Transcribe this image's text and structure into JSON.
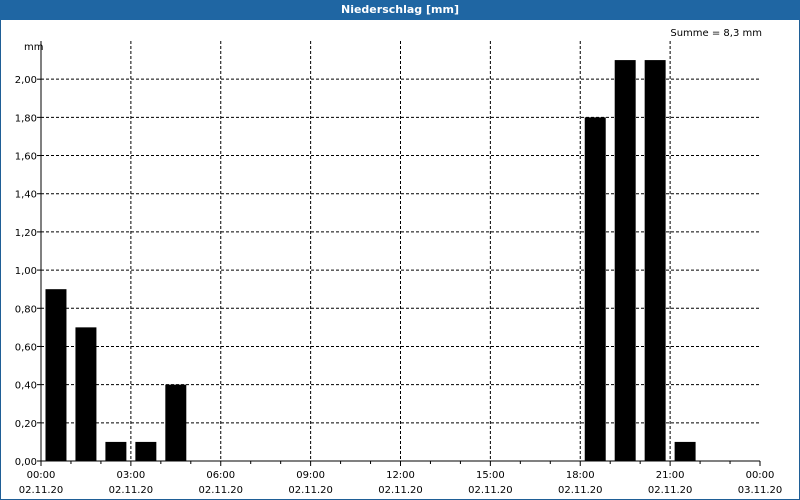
{
  "window": {
    "title": "Niederschlag [mm]"
  },
  "chart_data": {
    "type": "bar",
    "title": "Niederschlag [mm]",
    "ylabel": "mm",
    "ylim": [
      0,
      2.2
    ],
    "yticks": [
      "0,00",
      "0,20",
      "0,40",
      "0,60",
      "0,80",
      "1,00",
      "1,20",
      "1,40",
      "1,60",
      "1,80",
      "2,00"
    ],
    "xticks": [
      {
        "time": "00:00",
        "date": "02.11.20"
      },
      {
        "time": "03:00",
        "date": "02.11.20"
      },
      {
        "time": "06:00",
        "date": "02.11.20"
      },
      {
        "time": "09:00",
        "date": "02.11.20"
      },
      {
        "time": "12:00",
        "date": "02.11.20"
      },
      {
        "time": "15:00",
        "date": "02.11.20"
      },
      {
        "time": "18:00",
        "date": "02.11.20"
      },
      {
        "time": "21:00",
        "date": "02.11.20"
      },
      {
        "time": "00:00",
        "date": "03.11.20"
      }
    ],
    "xrange_hours": [
      0,
      24
    ],
    "bars": [
      {
        "start": "00:00",
        "end": "01:00",
        "value": 0.9
      },
      {
        "start": "01:00",
        "end": "02:00",
        "value": 0.7
      },
      {
        "start": "02:00",
        "end": "03:00",
        "value": 0.1
      },
      {
        "start": "03:00",
        "end": "04:00",
        "value": 0.1
      },
      {
        "start": "04:00",
        "end": "05:00",
        "value": 0.4
      },
      {
        "start": "18:00",
        "end": "19:00",
        "value": 1.8
      },
      {
        "start": "19:00",
        "end": "20:00",
        "value": 2.1
      },
      {
        "start": "20:00",
        "end": "21:00",
        "value": 2.1
      },
      {
        "start": "21:00",
        "end": "22:00",
        "value": 0.1
      }
    ],
    "annotation": "Summe = 8,3 mm",
    "grid": true,
    "bar_color": "#000000"
  }
}
